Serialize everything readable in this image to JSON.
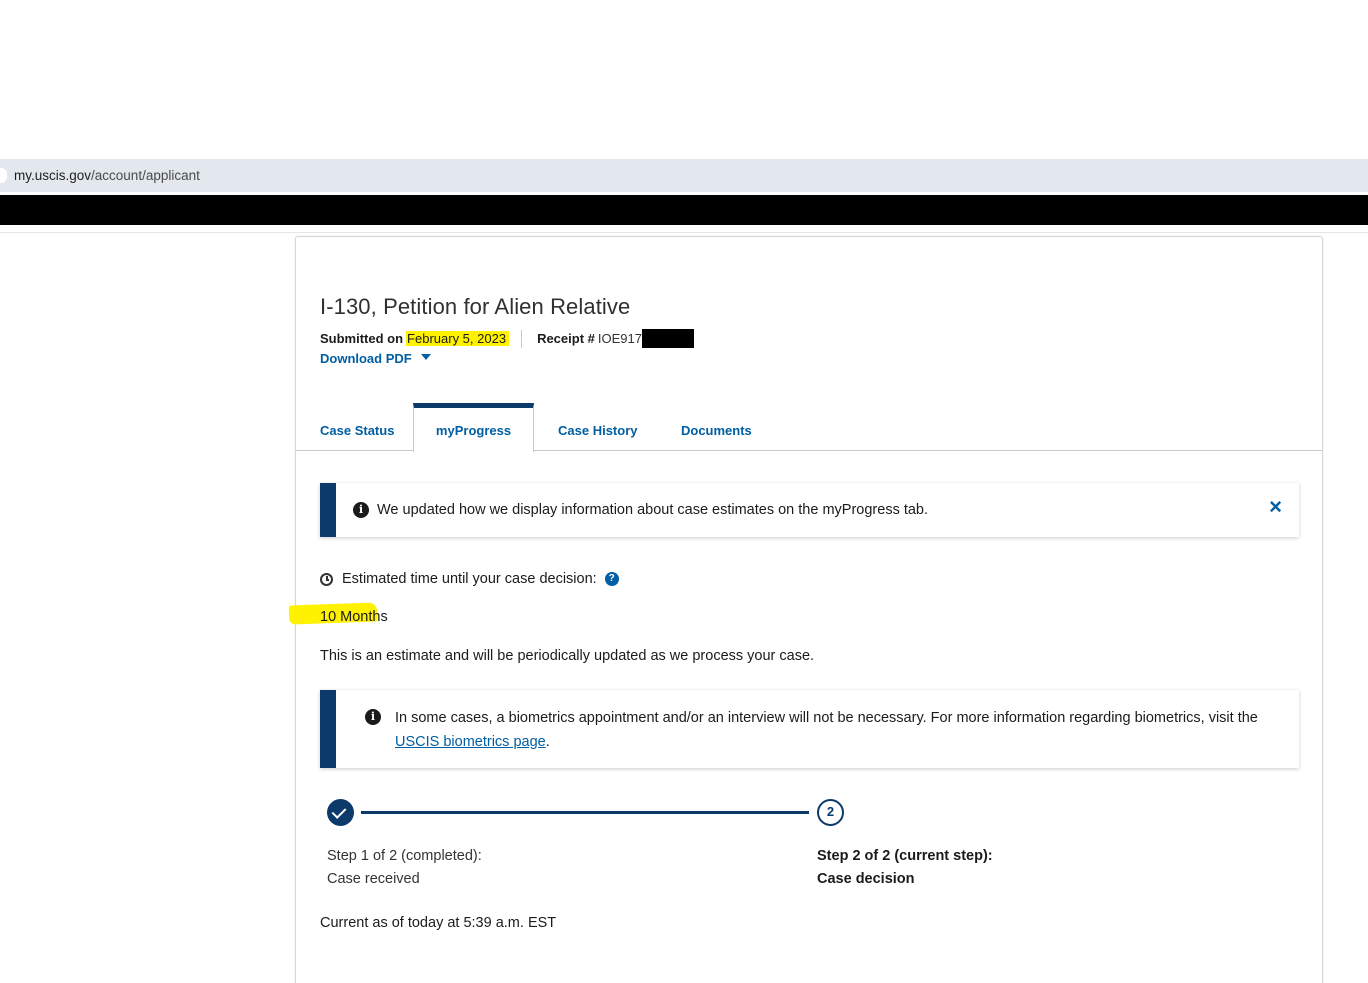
{
  "browser": {
    "url_domain": "my.uscis.gov",
    "url_path": "/account/applicant"
  },
  "case": {
    "title": "I-130, Petition for Alien Relative",
    "submitted_label": "Submitted on",
    "submitted_date": "February 5, 2023",
    "receipt_label": "Receipt #",
    "receipt_value": "IOE917",
    "download_label": "Download PDF"
  },
  "tabs": [
    {
      "label": "Case Status",
      "active": false
    },
    {
      "label": "myProgress",
      "active": true
    },
    {
      "label": "Case History",
      "active": false
    },
    {
      "label": "Documents",
      "active": false
    }
  ],
  "notice": {
    "text": "We updated how we display information about case estimates on the myProgress tab.",
    "close": "×"
  },
  "estimate": {
    "label": "Estimated time until your case decision:",
    "help": "?",
    "value": "10 Months",
    "note": "This is an estimate and will be periodically updated as we process your case."
  },
  "biometrics": {
    "text": "In some cases, a biometrics appointment and/or an interview will not be necessary. For more information regarding biometrics, visit the",
    "link": "USCIS biometrics page",
    "after": "."
  },
  "steps": [
    {
      "number": "1",
      "line1": "Step 1 of 2 (completed):",
      "line2": "Case received",
      "status": "completed"
    },
    {
      "number": "2",
      "line1": "Step 2 of 2 (current step):",
      "line2": "Case decision",
      "status": "current"
    }
  ],
  "footer": {
    "current_as_of": "Current as of today at 5:39 a.m. EST"
  },
  "colors": {
    "navy": "#0b3a6b",
    "link": "#005ea2",
    "highlight": "#fff200"
  }
}
